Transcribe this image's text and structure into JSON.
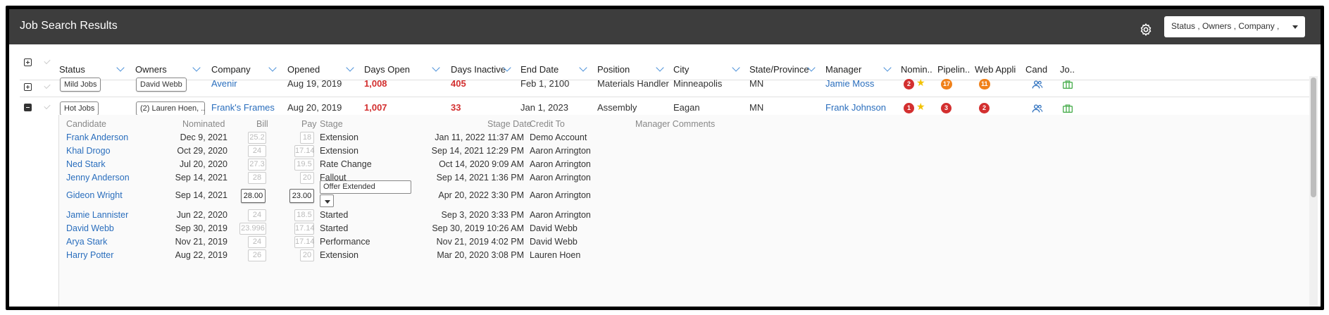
{
  "header": {
    "title": "Job Search Results",
    "filter_select": "Status , Owners , Company ,"
  },
  "columns": [
    "Status",
    "Owners",
    "Company",
    "Opened",
    "Days Open",
    "Days Inactive",
    "End Date",
    "Position",
    "City",
    "State/Province",
    "Manager",
    "Nominee",
    "Pipeline",
    "Web Appli",
    "Cand",
    "Jo"
  ],
  "column_display": [
    "Status",
    "Owners",
    "Company",
    "Opened",
    "Days Open",
    "Days Inactive",
    "End Date",
    "Position",
    "City",
    "State/Province",
    "Manager",
    "Nomin..",
    "Pipelin..",
    "Web Appli",
    "Cand",
    "Jo.."
  ],
  "jobs": [
    {
      "status": "Mild Jobs",
      "owners": "David Webb",
      "company": "Avenir",
      "opened": "Aug 19, 2019",
      "days_open": "1,008",
      "days_inactive": "405",
      "end_date": "Feb 1, 2100",
      "position": "Materials Handler",
      "city": "Minneapolis",
      "state": "MN",
      "manager": "Jamie Moss",
      "nominees": "2",
      "pipeline": "17",
      "web_applicants": "11"
    },
    {
      "status": "Hot Jobs",
      "owners": "(2) Lauren Hoen, ...",
      "company": "Frank's Frames",
      "opened": "Aug 20, 2019",
      "days_open": "1,007",
      "days_inactive": "33",
      "end_date": "Jan 1, 2023",
      "position": "Assembly",
      "city": "Eagan",
      "state": "MN",
      "manager": "Frank Johnson",
      "nominees": "1",
      "pipeline": "3",
      "web_applicants": "2"
    }
  ],
  "subtable": {
    "headers": {
      "candidate": "Candidate",
      "nominated": "Nominated",
      "bill": "Bill",
      "pay": "Pay",
      "stage": "Stage",
      "stage_date": "Stage Date",
      "credit_to": "Credit To",
      "manager_comments": "Manager Comments"
    },
    "rows": [
      {
        "candidate": "Frank Anderson",
        "nominated": "Dec 9, 2021",
        "bill": "25.2",
        "pay": "18",
        "stage": "Extension",
        "stage_date": "Jan 11, 2022 11:37 AM",
        "credit_to": "Demo Account"
      },
      {
        "candidate": "Khal Drogo",
        "nominated": "Oct 29, 2020",
        "bill": "24",
        "pay": "17.14",
        "stage": "Extension",
        "stage_date": "Sep 14, 2021 12:29 PM",
        "credit_to": "Aaron Arrington"
      },
      {
        "candidate": "Ned Stark",
        "nominated": "Jul 20, 2020",
        "bill": "27.3",
        "pay": "19.5",
        "stage": "Rate Change",
        "stage_date": "Oct 14, 2020 9:09 AM",
        "credit_to": "Aaron Arrington"
      },
      {
        "candidate": "Jenny Anderson",
        "nominated": "Sep 14, 2021",
        "bill": "28",
        "pay": "20",
        "stage": "Fallout",
        "stage_date": "Sep 14, 2021 1:36 PM",
        "credit_to": "Aaron Arrington"
      },
      {
        "candidate": "Gideon Wright",
        "nominated": "Sep 14, 2021",
        "bill": "28.00",
        "pay": "23.00",
        "stage": "Offer Extended",
        "stage_date": "Apr 20, 2022 3:30 PM",
        "credit_to": "Aaron Arrington"
      },
      {
        "candidate": "Jamie Lannister",
        "nominated": "Jun 22, 2020",
        "bill": "24",
        "pay": "18.5",
        "stage": "Started",
        "stage_date": "Sep 3, 2020 3:33 PM",
        "credit_to": "Aaron Arrington"
      },
      {
        "candidate": "David Webb",
        "nominated": "Sep 30, 2019",
        "bill": "23.996",
        "pay": "17.14",
        "stage": "Started",
        "stage_date": "Sep 30, 2019 10:26 AM",
        "credit_to": "David Webb"
      },
      {
        "candidate": "Arya Stark",
        "nominated": "Nov 21, 2019",
        "bill": "24",
        "pay": "17.14",
        "stage": "Performance",
        "stage_date": "Nov 21, 2019 4:02 PM",
        "credit_to": "David Webb"
      },
      {
        "candidate": "Harry Potter",
        "nominated": "Aug 22, 2019",
        "bill": "26",
        "pay": "20",
        "stage": "Extension",
        "stage_date": "Mar 20, 2020 3:08 PM",
        "credit_to": "Lauren Hoen"
      }
    ]
  },
  "colors": {
    "header_bg": "#3d3d3d",
    "link": "#2a6ebd",
    "danger": "#d32f2f",
    "orange": "#f0811a",
    "star": "#f2c200",
    "green_icon": "#4caf50"
  },
  "icons": {
    "settings": "gear-icon",
    "candidates": "people-icon",
    "jobs": "briefcase-icon"
  }
}
